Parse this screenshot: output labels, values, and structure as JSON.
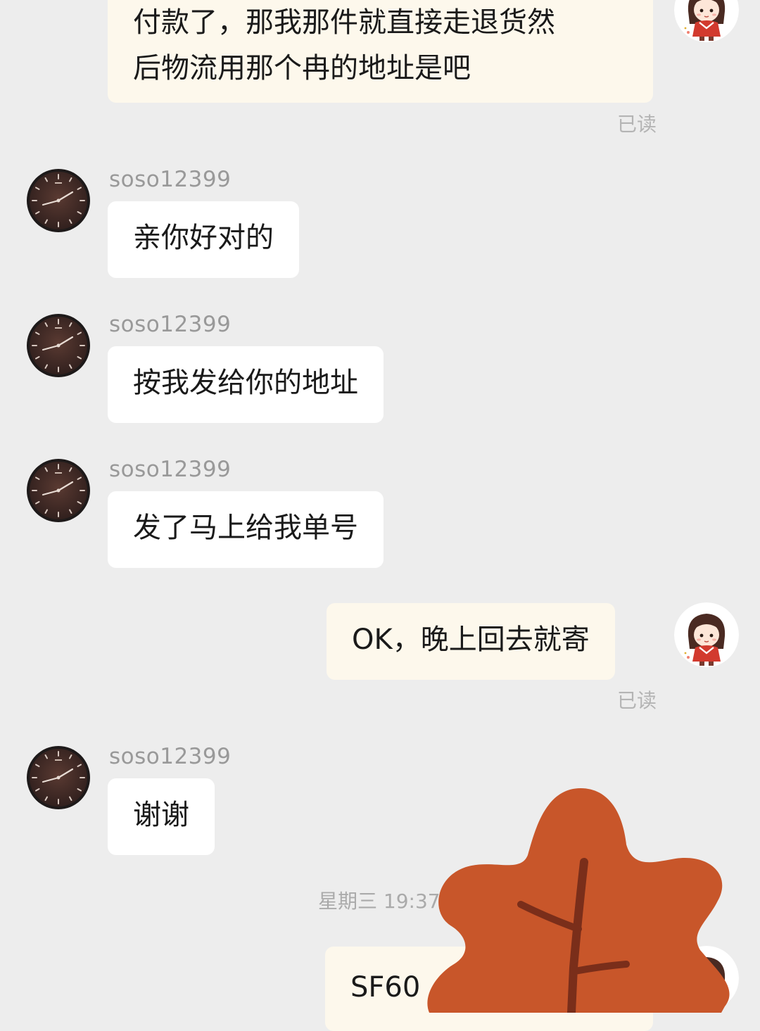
{
  "messages": {
    "m1": {
      "text_line1": "付款了，那我那件就直接走退货然",
      "text_line2": "后物流用那个冉的地址是吧",
      "status": "已读"
    },
    "m2": {
      "sender": "soso12399",
      "text": "亲你好对的"
    },
    "m3": {
      "sender": "soso12399",
      "text": "按我发给你的地址"
    },
    "m4": {
      "sender": "soso12399",
      "text": "发了马上给我单号"
    },
    "m5": {
      "text": "OK，晚上回去就寄",
      "status": "已读"
    },
    "m6": {
      "sender": "soso12399",
      "text": "谢谢"
    },
    "timestamp": "星期三 19:37",
    "m7": {
      "text": "SF60"
    }
  },
  "icons": {
    "contact_avatar": "wall-clock-avatar",
    "self_avatar": "cartoon-girl-avatar",
    "overlay": "maple-leaf-sticker"
  },
  "colors": {
    "background": "#ededed",
    "incoming_bubble": "#ffffff",
    "outgoing_bubble": "#fdf8ec",
    "leaf": "#c8562a"
  }
}
